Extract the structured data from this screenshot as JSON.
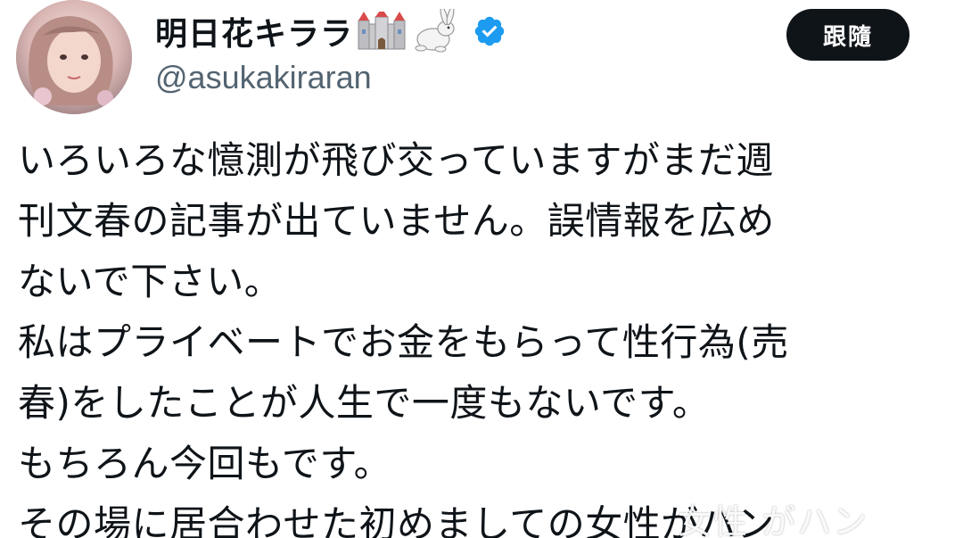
{
  "profile": {
    "display_name": "明日花キララ",
    "emoji_icons": [
      "castle-icon",
      "rabbit-icon"
    ],
    "verified_icon": "verified-badge-icon",
    "handle": "@asukakiraran"
  },
  "follow_button": {
    "label": "跟隨"
  },
  "tweet": {
    "lines": [
      "いろいろな憶測が飛び交っていますがまだ週",
      "刊文春の記事が出ていません。誤情報を広め",
      "ないで下さい。",
      "私はプライベートでお金をもらって性行為(売",
      "春)をしたことが人生で一度もないです。",
      "もちろん今回もです。",
      "その場に居合わせた初めましての女性がハン"
    ]
  },
  "watermark": {
    "text": "女性 がハン"
  },
  "colors": {
    "button_bg": "#0f1419",
    "handle": "#536471",
    "verified": "#1d9bf0",
    "text": "#0f1419"
  }
}
